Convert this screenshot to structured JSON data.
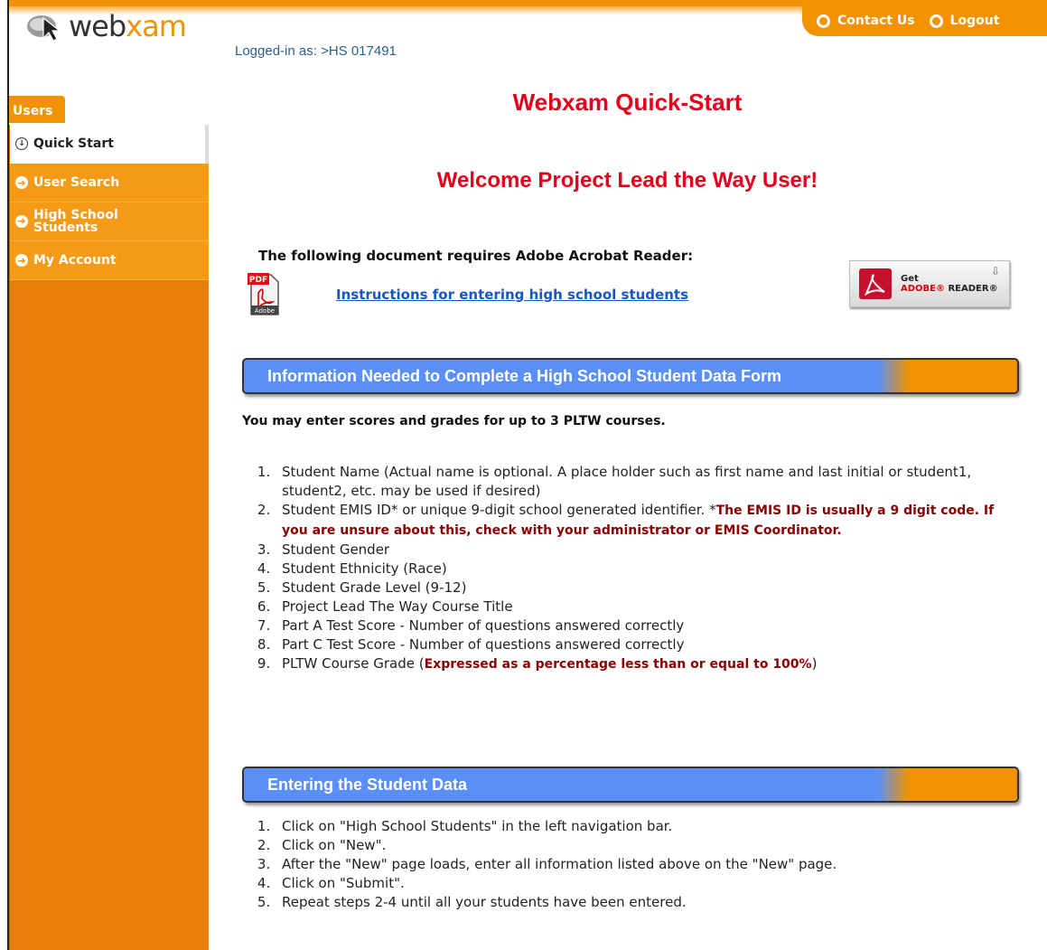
{
  "header": {
    "contact_label": "Contact Us",
    "logout_label": "Logout"
  },
  "logo": {
    "text_web": "web",
    "text_xam": "xam"
  },
  "sidebar": {
    "tab": "Users",
    "items": [
      {
        "label": "Quick Start"
      },
      {
        "label": "User Search"
      },
      {
        "label": "High School Students"
      },
      {
        "label": "My Account"
      }
    ]
  },
  "main": {
    "logged_in": "Logged-in as: >HS 017491",
    "title": "Webxam Quick-Start",
    "welcome": "Welcome Project Lead the Way User!",
    "requires": "The following document requires Adobe Acrobat Reader:",
    "doc_link": "Instructions for entering high school students",
    "adobe_get": "Get",
    "adobe_reader_brand": "ADOBE® ",
    "adobe_reader_word": "READER®",
    "pdf_label": "PDF",
    "pdf_sub": "Adobe",
    "section1": {
      "title": "Information Needed to Complete a High School Student Data Form",
      "note": "You may enter scores and grades for up to 3 PLTW courses.",
      "items": [
        "Student Name (Actual name is optional. A place holder such as first name and last initial or student1, student2, etc. may be used if desired)",
        "Student EMIS ID* or unique 9-digit school generated identifier. *",
        "Student Gender",
        "Student Ethnicity (Race)",
        "Student Grade Level (9-12)",
        "Project Lead The Way Course Title",
        "Part A Test Score - Number of questions answered correctly",
        "Part C Test Score - Number of questions answered correctly",
        "PLTW Course Grade ("
      ],
      "item2_emph": "The EMIS ID is usually a 9 digit code. If you are unsure about this, check with your administrator or EMIS Coordinator.",
      "item9_emph": "Expressed as a percentage less than or equal to 100%",
      "item9_close": ")"
    },
    "section2": {
      "title": "Entering the Student Data",
      "items": [
        "Click on \"High School Students\" in the left navigation bar.",
        "Click on \"New\".",
        "After the \"New\" page loads, enter all information listed above on the \"New\" page.",
        "Click on \"Submit\".",
        "Repeat steps 2-4 until all your students have been entered."
      ]
    }
  }
}
